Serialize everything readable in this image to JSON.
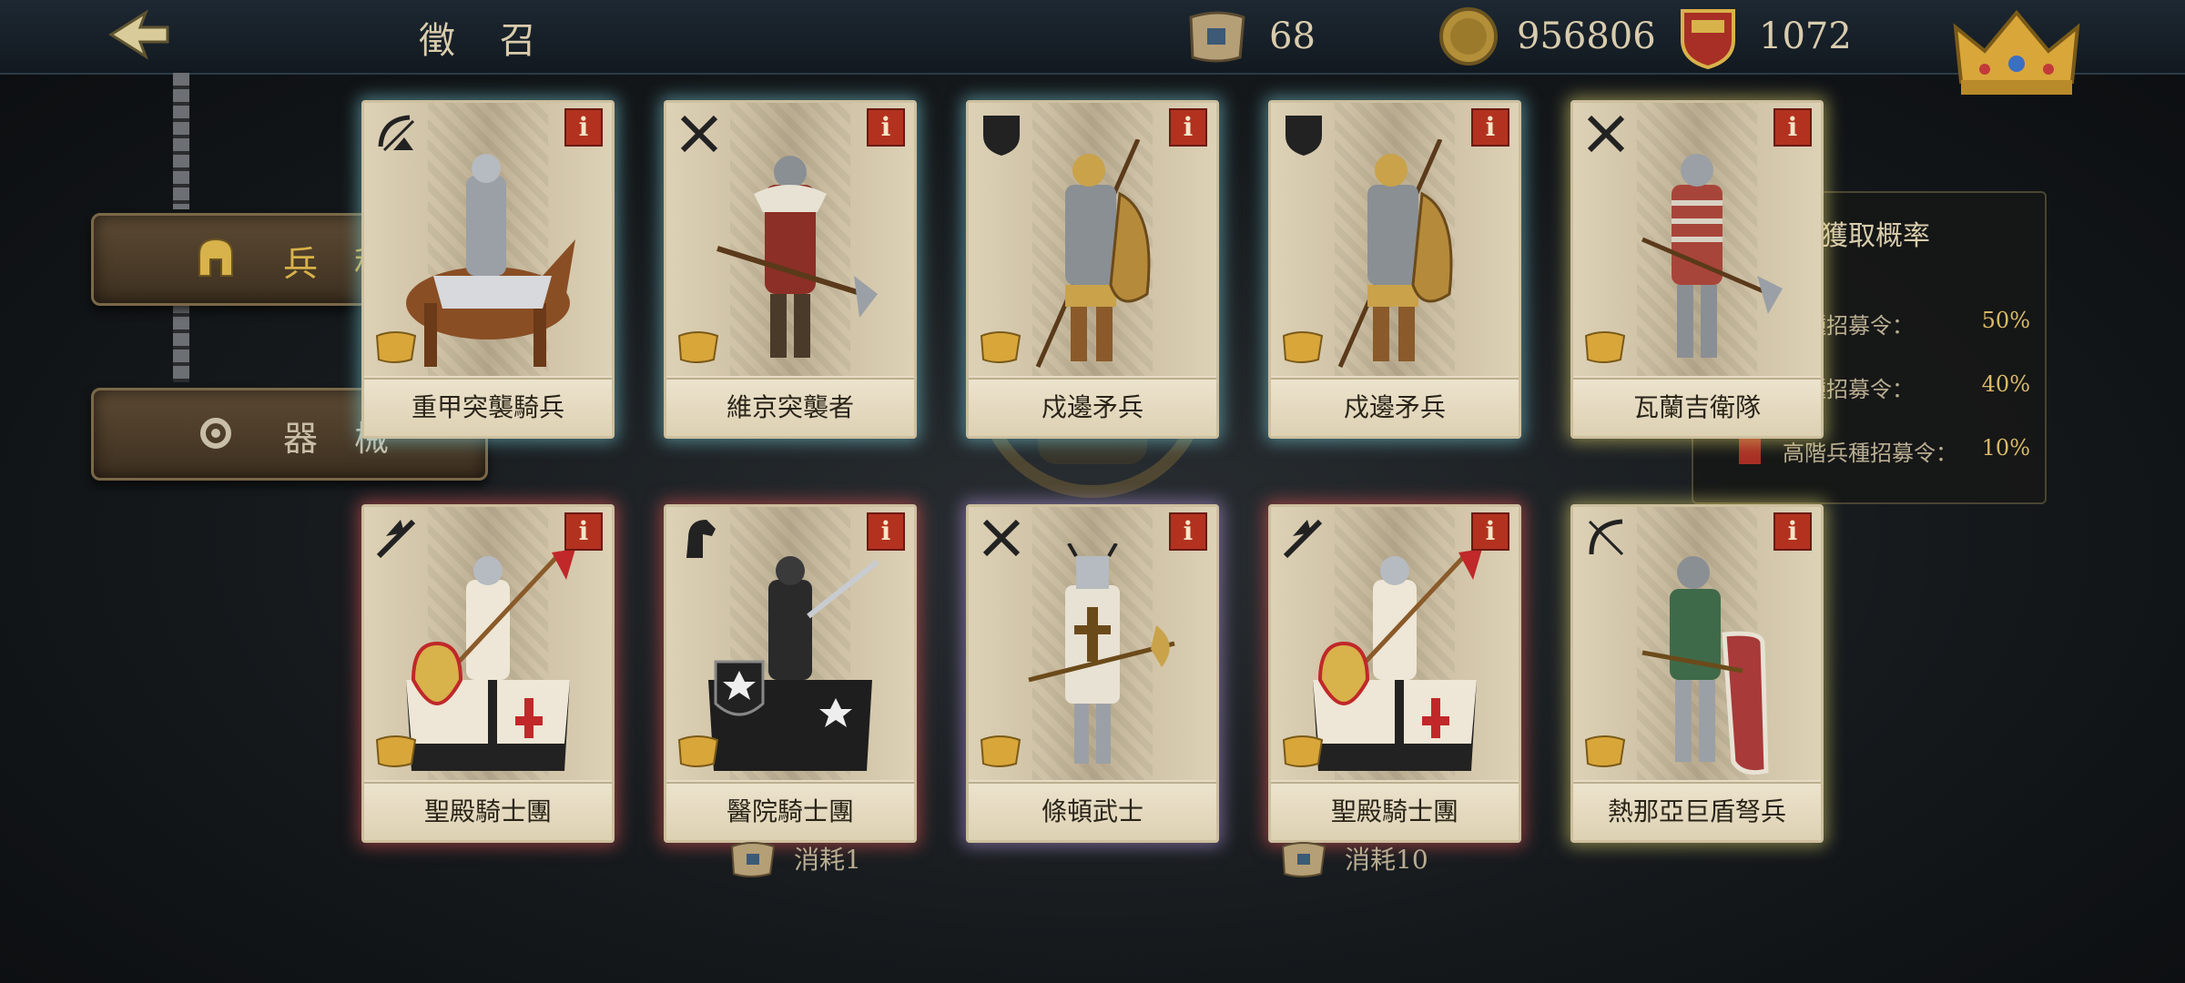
{
  "header": {
    "title": "徵 召"
  },
  "resources": [
    {
      "icon": "recruit-scroll-icon",
      "value": "68"
    },
    {
      "icon": "gold-coin-icon",
      "value": "956806"
    },
    {
      "icon": "crest-icon",
      "value": "1072"
    }
  ],
  "sidebar": {
    "items": [
      {
        "icon": "helmet-icon",
        "label": "兵種"
      },
      {
        "icon": "gear-icon",
        "label": "器械"
      }
    ]
  },
  "probability": {
    "title": "獲取概率",
    "rows": [
      {
        "label": "兵種招募令：",
        "value": "50%"
      },
      {
        "label": "兵種招募令：",
        "value": "40%"
      },
      {
        "label": "高階兵種招募令：",
        "value": "10%"
      }
    ]
  },
  "cards": [
    {
      "name": "重甲突襲騎兵",
      "type_icon": "bow-cavalry-icon",
      "glow": "teal"
    },
    {
      "name": "維京突襲者",
      "type_icon": "crossed-swords-icon",
      "glow": "teal"
    },
    {
      "name": "戍邊矛兵",
      "type_icon": "shield-icon",
      "glow": "teal"
    },
    {
      "name": "戍邊矛兵",
      "type_icon": "shield-icon",
      "glow": "teal"
    },
    {
      "name": "瓦蘭吉衛隊",
      "type_icon": "crossed-swords-icon",
      "glow": "yellow"
    },
    {
      "name": "聖殿騎士團",
      "type_icon": "lance-icon",
      "glow": "red"
    },
    {
      "name": "醫院騎士團",
      "type_icon": "horse-head-icon",
      "glow": "red"
    },
    {
      "name": "條頓武士",
      "type_icon": "crossed-swords-icon",
      "glow": "purple"
    },
    {
      "name": "聖殿騎士團",
      "type_icon": "lance-icon",
      "glow": "red"
    },
    {
      "name": "熱那亞巨盾弩兵",
      "type_icon": "bow-icon",
      "glow": "yellow"
    }
  ],
  "costs": [
    {
      "icon": "recruit-scroll-icon",
      "label": "消耗1"
    },
    {
      "icon": "recruit-scroll-icon",
      "label": "消耗10"
    }
  ],
  "info_label": "i",
  "colors": {
    "accent_gold": "#d8b24a",
    "info_red": "#b2321f",
    "card_bg": "#e6dcc4"
  }
}
